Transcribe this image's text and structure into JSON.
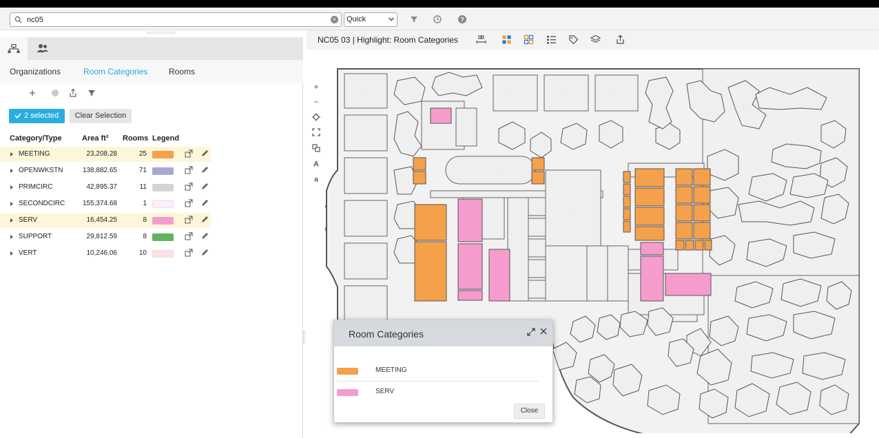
{
  "search": {
    "value": "nc05",
    "mode": "Quick"
  },
  "left": {
    "nav_tabs": [
      "Organizations",
      "Room Categories",
      "Rooms"
    ],
    "active_tab": "Room Categories",
    "selection_label": "2 selected",
    "clear_label": "Clear Selection",
    "columns": [
      "Category/Type",
      "Area ft²",
      "Rooms",
      "Legend"
    ],
    "rows": [
      {
        "name": "MEETING",
        "area": "23,208.28",
        "rooms": "25",
        "color": "#f5a04a",
        "highlighted": true
      },
      {
        "name": "OPENWKSTN",
        "area": "138,882.65",
        "rooms": "71",
        "color": "#a9a7d6",
        "highlighted": false
      },
      {
        "name": "PRIMCIRC",
        "area": "42,895.37",
        "rooms": "11",
        "color": "#d4d4d4",
        "highlighted": false
      },
      {
        "name": "SECONDCIRC",
        "area": "155,374.68",
        "rooms": "1",
        "color": "#fdf0fb",
        "highlighted": false
      },
      {
        "name": "SERV",
        "area": "16,454.25",
        "rooms": "8",
        "color": "#f59ccd",
        "highlighted": true
      },
      {
        "name": "SUPPORT",
        "area": "29,812.59",
        "rooms": "8",
        "color": "#5fb35c",
        "highlighted": false
      },
      {
        "name": "VERT",
        "area": "10,246.06",
        "rooms": "10",
        "color": "#fbe2e4",
        "highlighted": false
      }
    ]
  },
  "drawing": {
    "title": "NC05 03 | Highlight: Room Categories"
  },
  "popup": {
    "title": "Room Categories",
    "items": [
      {
        "label": "MEETING",
        "color": "#f5a04a"
      },
      {
        "label": "SERV",
        "color": "#f59ccd"
      }
    ],
    "close_label": "Close"
  },
  "colors": {
    "accent": "#2aaee0",
    "meeting": "#f5a04a",
    "serv": "#f59ccd",
    "room": "#efefef",
    "wall": "#555555"
  }
}
